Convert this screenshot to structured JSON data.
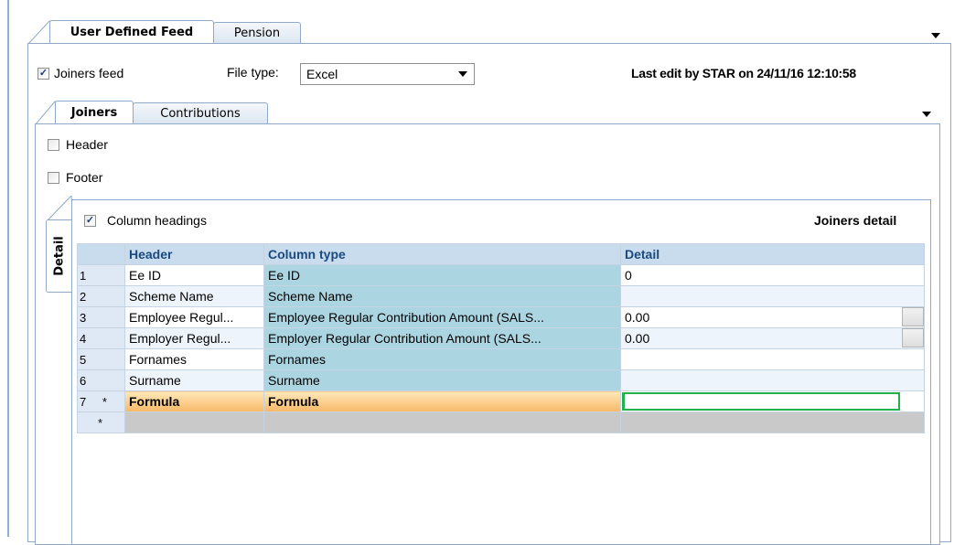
{
  "tabs": [
    {
      "label": "User Defined Feed",
      "active": true
    },
    {
      "label": "Pension",
      "active": false
    }
  ],
  "joiners_feed": {
    "label": "Joiners feed",
    "checked": true
  },
  "file_type": {
    "label": "File type:",
    "value": "Excel"
  },
  "last_edit": "Last edit by STAR on 24/11/16 12:10:58",
  "subtabs": [
    {
      "label": "Joiners",
      "active": true
    },
    {
      "label": "Contributions",
      "active": false
    }
  ],
  "header_cb": {
    "label": "Header",
    "checked": false
  },
  "footer_cb": {
    "label": "Footer",
    "checked": false
  },
  "detail_tab": "Detail",
  "column_headings": {
    "label": "Column headings",
    "checked": true
  },
  "joiners_detail": "Joiners detail",
  "grid": {
    "columns": [
      "Header",
      "Column type",
      "Detail"
    ],
    "rows": [
      {
        "num": "1",
        "header": "Ee ID",
        "type": "Ee ID",
        "detail": "0"
      },
      {
        "num": "2",
        "header": "Scheme Name",
        "type": "Scheme Name",
        "detail": ""
      },
      {
        "num": "3",
        "header": "Employee Regul...",
        "type": "Employee Regular Contribution Amount (SALS...",
        "detail": "0.00"
      },
      {
        "num": "4",
        "header": "Employer Regul...",
        "type": "Employer Regular Contribution Amount (SALS...",
        "detail": "0.00"
      },
      {
        "num": "5",
        "header": "Fornames",
        "type": "Fornames",
        "detail": ""
      },
      {
        "num": "6",
        "header": "Surname",
        "type": "Surname",
        "detail": ""
      },
      {
        "num": "7",
        "header": "Formula",
        "type": "Formula",
        "detail": ""
      }
    ],
    "new_row_marker": "*",
    "editing_marker": "*"
  },
  "colors": {
    "accent_border": "#8ea9c9",
    "column_type_bg": "#acd5e2",
    "selected_row": "#f9b867",
    "edit_border": "#22b14c"
  }
}
